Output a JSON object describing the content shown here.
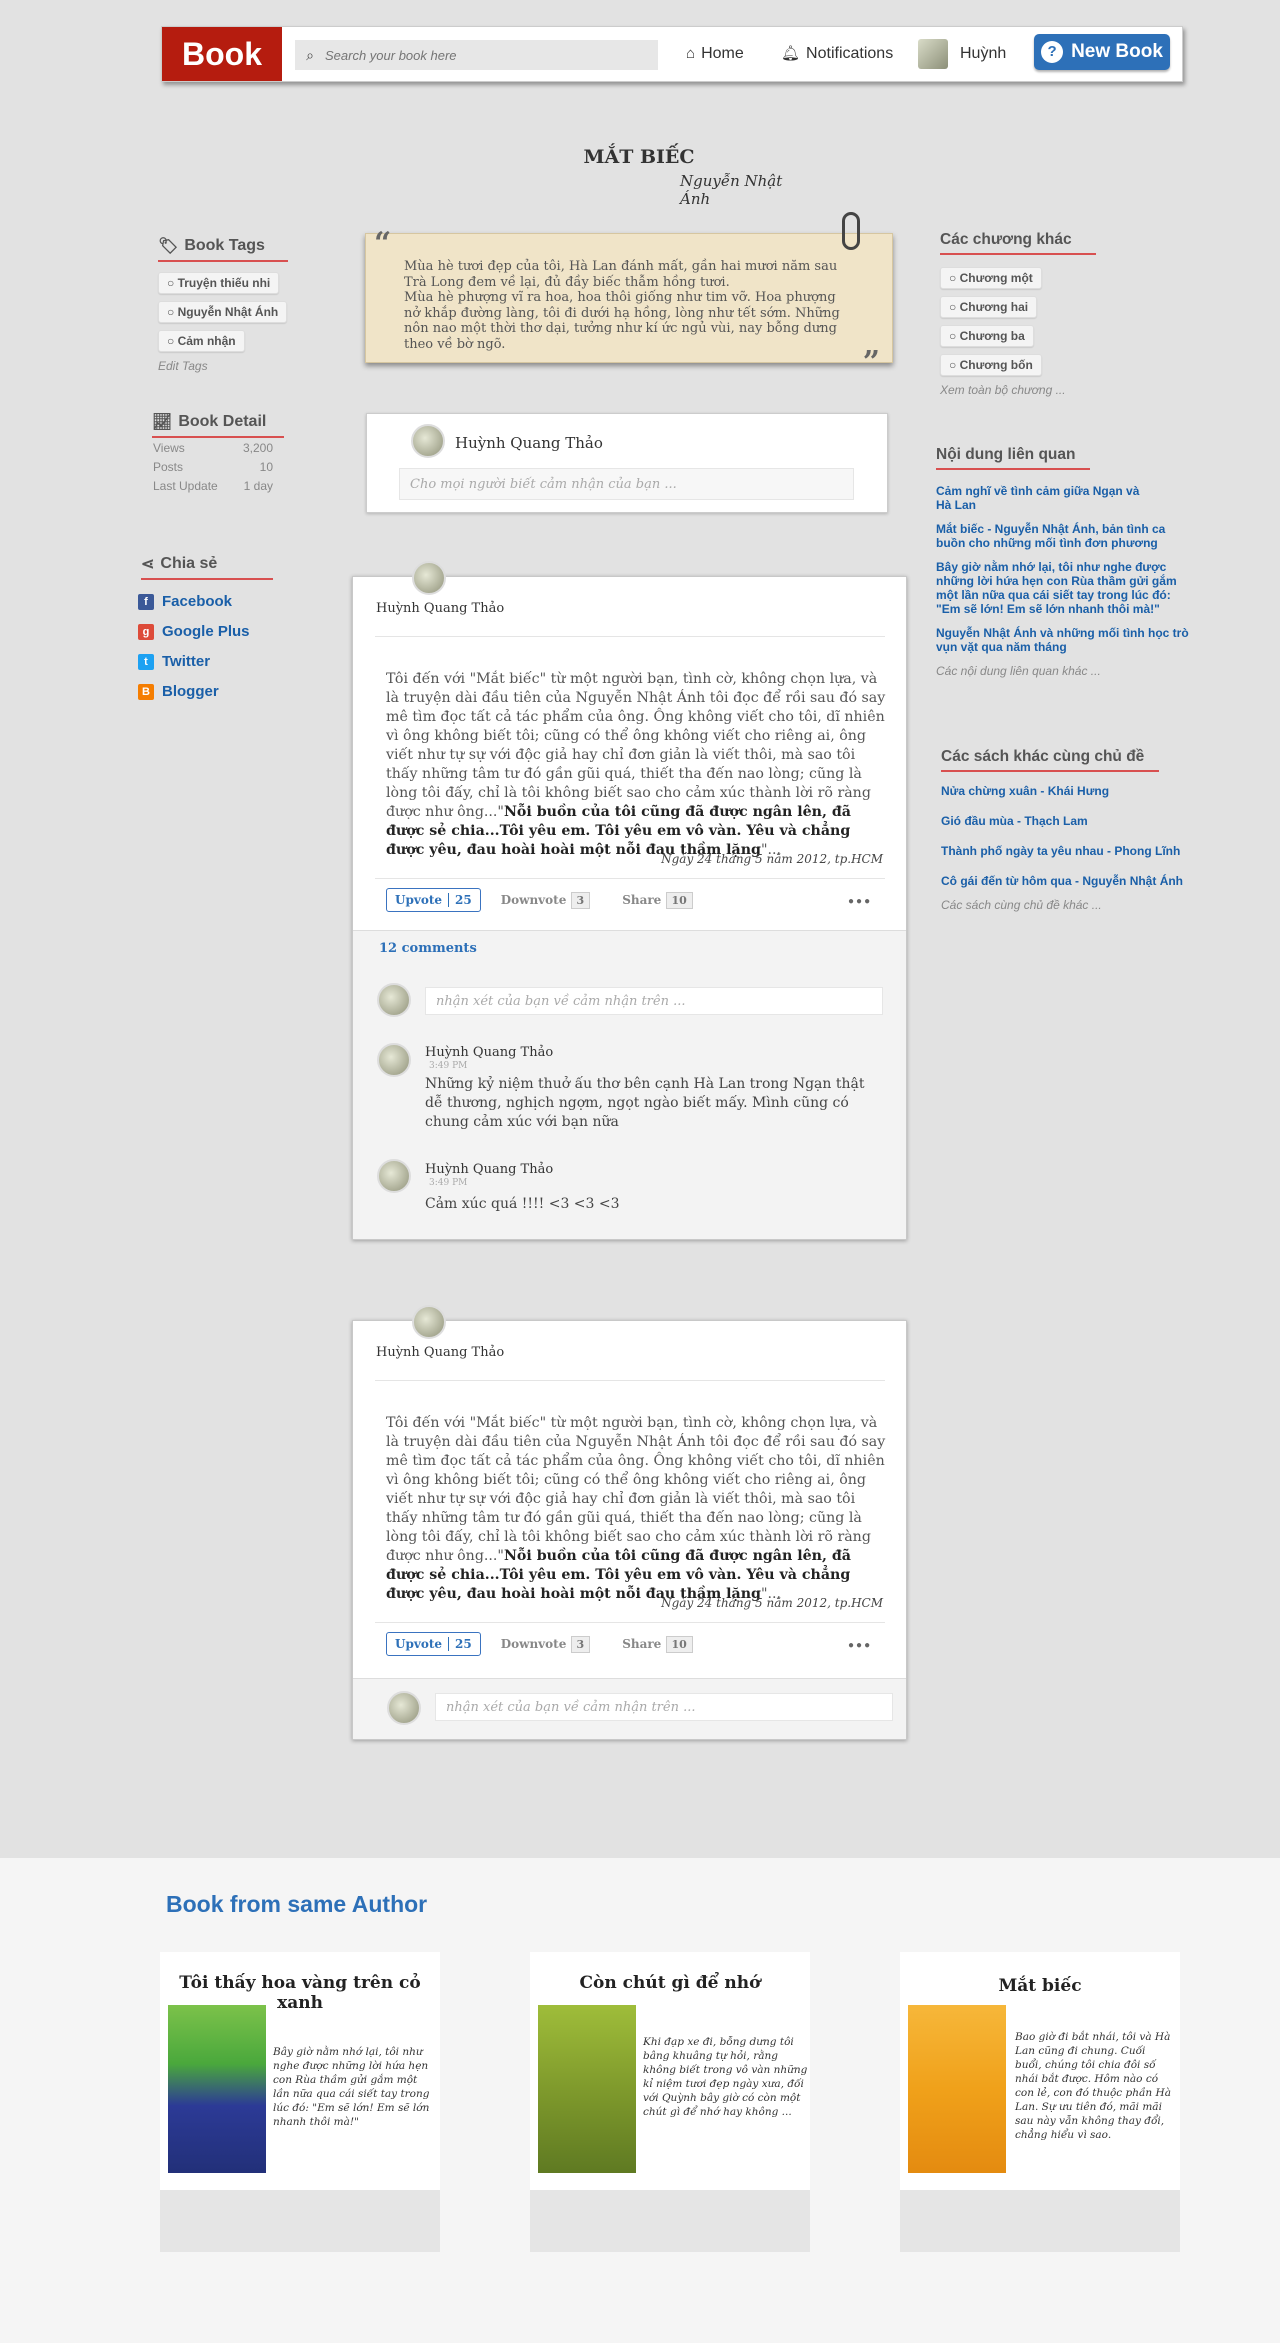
{
  "header": {
    "logo": "Book",
    "search_placeholder": "Search your book here",
    "home": "Home",
    "notifications": "Notifications",
    "user": "Huỳnh",
    "new_book": "New Book"
  },
  "book": {
    "title": "MẮT BIẾC",
    "author": "Nguyễn Nhật Ánh"
  },
  "sidebar": {
    "tags_title": "Book Tags",
    "tags": [
      "Truyện thiếu nhi",
      "Nguyễn Nhật Ánh",
      "Cảm nhận"
    ],
    "edit_tags": "Edit Tags",
    "detail_title": "Book Detail",
    "details": [
      {
        "label": "Views",
        "value": "3,200"
      },
      {
        "label": "Posts",
        "value": "10"
      },
      {
        "label": "Last Update",
        "value": "1 day"
      }
    ],
    "share_title": "Chia sẻ",
    "share": [
      "Facebook",
      "Google Plus",
      "Twitter",
      "Blogger"
    ]
  },
  "quote": {
    "line1": "Mùa hè tươi đẹp của tôi, Hà Lan đánh mất, gần hai mươi năm sau Trà Long đem về lại, đủ đầy biếc thẫm hồng tươi.",
    "line2": "Mùa hè phượng vĩ ra hoa, hoa thôi giống như tim vỡ. Hoa phượng nở khắp đường làng, tôi đi dưới hạ hồng, lòng như tết sớm. Những nôn nao một thời thơ dại, tưởng như kí ức ngủ vùi, nay bỗng dưng theo về bờ ngõ."
  },
  "composer": {
    "name": "Huỳnh Quang Thảo",
    "placeholder": "Cho mọi người biết cảm nhận của bạn ..."
  },
  "posts": [
    {
      "author": "Huỳnh Quang Thảo",
      "body_plain": "Tôi đến với \"Mắt biếc\" từ một người bạn, tình cờ, không chọn lựa, và là truyện dài đầu tiên của Nguyễn Nhật Ánh tôi đọc để rồi sau đó say mê tìm đọc tất cả tác phẩm của ông. Ông không viết cho tôi, dĩ nhiên vì ông không biết tôi; cũng có thể ông không viết cho riêng ai, ông viết như tự sự với độc giả hay chỉ đơn giản là viết thôi, mà sao tôi thấy những tâm tư đó gần gũi quá, thiết tha đến nao lòng; cũng là lòng tôi đấy, chỉ là tôi không biết sao cho cảm xúc thành lời rõ ràng được như ông...\"",
      "body_bold": "Nỗi buồn của tôi cũng đã được ngân lên, đã được sẻ chia...Tôi yêu em. Tôi yêu em vô vàn. Yêu và chẳng được yêu, đau hoài hoài một nỗi đau thầm lặng",
      "body_end": "\"...",
      "date": "Ngày 24 tháng 5 năm 2012, tp.HCM",
      "upvote": "Upvote",
      "upvote_count": "25",
      "downvote": "Downvote",
      "downvote_count": "3",
      "share": "Share",
      "share_count": "10",
      "comments_count": "12 comments",
      "comment_placeholder": "nhận xét của bạn về cảm nhận trên ...",
      "comments": [
        {
          "name": "Huỳnh Quang Thảo",
          "time": "3:49 PM",
          "text": "Những kỷ niệm thuở ấu thơ bên cạnh Hà Lan trong Ngạn thật dễ thương, nghịch ngợm, ngọt ngào biết mấy.  Mình cũng có chung cảm xúc với bạn nữa"
        },
        {
          "name": "Huỳnh Quang Thảo",
          "time": "3:49 PM",
          "text": "Cảm xúc quá !!!! <3 <3 <3"
        }
      ]
    },
    {
      "author": "Huỳnh Quang Thảo",
      "date": "Ngày 24 tháng 5 năm 2012, tp.HCM",
      "upvote": "Upvote",
      "upvote_count": "25",
      "downvote": "Downvote",
      "downvote_count": "3",
      "share": "Share",
      "share_count": "10",
      "comment_placeholder": "nhận xét của bạn về cảm nhận trên ..."
    }
  ],
  "right": {
    "chapters_title": "Các chương khác",
    "chapters": [
      "Chương một",
      "Chương hai",
      "Chương ba",
      "Chương bốn"
    ],
    "chapters_more": "Xem toàn bộ chương ...",
    "related_title": "Nội dung liên quan",
    "related": [
      "Cảm nghĩ về tình cảm giữa Ngạn và Hà Lan",
      "Mắt biếc - Nguyễn Nhật Ánh, bản tình ca buồn cho những mối tình đơn phương",
      "Bây giờ nằm nhớ lại, tôi như nghe được những lời hứa hẹn con Rùa thầm gửi gắm một lần nữa qua cái siết tay trong lúc đó: \"Em sẽ lớn! Em sẽ lớn nhanh thôi mà!\"",
      "Nguyễn Nhật Ánh và những mối tình học trò vụn vặt qua năm tháng"
    ],
    "related_more": "Các nội dung liên quan khác ...",
    "same_topic_title": "Các sách khác cùng chủ đề",
    "same_topic": [
      "Nửa chừng xuân - Khái Hưng",
      "Gió đầu mùa - Thạch Lam",
      "Thành phố ngày ta yêu nhau - Phong Lĩnh",
      "Cô gái đến từ hôm qua - Nguyễn Nhật Ánh"
    ],
    "same_topic_more": "Các sách cùng chủ đề khác ..."
  },
  "footer": {
    "title": "Book from same Author",
    "books": [
      {
        "title": "Tôi thấy hoa vàng trên cỏ xanh",
        "text": "Bây giờ nằm nhớ lại, tôi như nghe được những lời hứa hẹn con Rùa thầm gửi gắm một lần nữa qua cái siết tay trong lúc đó: \"Em sẽ lớn! Em sẽ lớn nhanh thôi mà!\"",
        "cover_color": "#3a4aa0"
      },
      {
        "title": "Còn chút gì để nhớ",
        "text": "Khi đạp xe đi, bỗng dưng tôi bâng khuâng tự hỏi, rằng không biết trong vô vàn những kỉ niệm tươi đẹp ngày xưa, đối với Quỳnh bây giờ có còn một chút gì để nhớ hay không ...",
        "cover_color": "#7f9a2c"
      },
      {
        "title": "Mắt biếc",
        "text": "Bao giờ đi bắt nhái, tôi và Hà Lan cũng đi chung. Cuối buổi, chúng tôi chia đôi số nhái bắt được. Hôm nào có con lẻ, con đó thuộc phần Hà Lan. Sự ưu tiên đó, mãi mãi sau này vẫn không thay đổi, chẳng hiểu vì sao.",
        "cover_color": "#f0a11a"
      }
    ]
  }
}
